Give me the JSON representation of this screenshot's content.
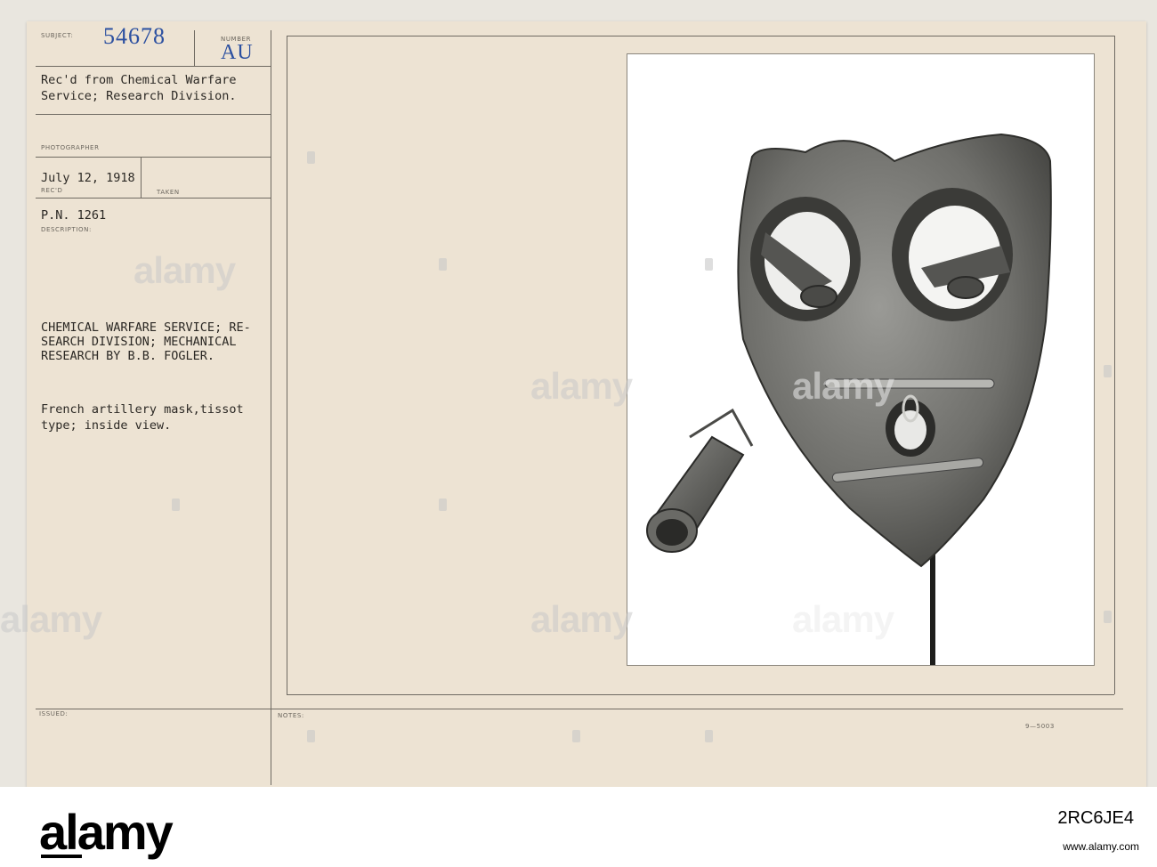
{
  "card": {
    "subject_label": "SUBJECT:",
    "subject_value": "54678",
    "number_label": "NUMBER",
    "number_value": "AU",
    "received_line1": "Rec'd from Chemical Warfare",
    "received_line2": "Service; Research Division.",
    "photographer_label": "PHOTOGRAPHER",
    "date_value": "July 12, 1918",
    "recd_label": "REC'D",
    "taken_label": "TAKEN",
    "pn_value": "P.N. 1261",
    "description_label": "DESCRIPTION:",
    "desc_line1": "CHEMICAL WARFARE SERVICE; RE-",
    "desc_line2": "SEARCH DIVISION; MECHANICAL",
    "desc_line3": "RESEARCH BY B.B. FOGLER.",
    "caption_line1": "French artillery mask,tissot",
    "caption_line2": "type; inside view.",
    "issued_label": "ISSUED:",
    "notes_label": "NOTES:",
    "form_code": "9—5003"
  },
  "watermark": {
    "text": "alamy"
  },
  "footer": {
    "brand": "alamy",
    "image_id": "2RC6JE4",
    "url": "www.alamy.com"
  },
  "colors": {
    "card_bg": "#ede3d3",
    "stamp_blue": "#2c50a0",
    "rule": "#6f6a62"
  },
  "icons": {
    "photo": "gas-mask-photo"
  }
}
